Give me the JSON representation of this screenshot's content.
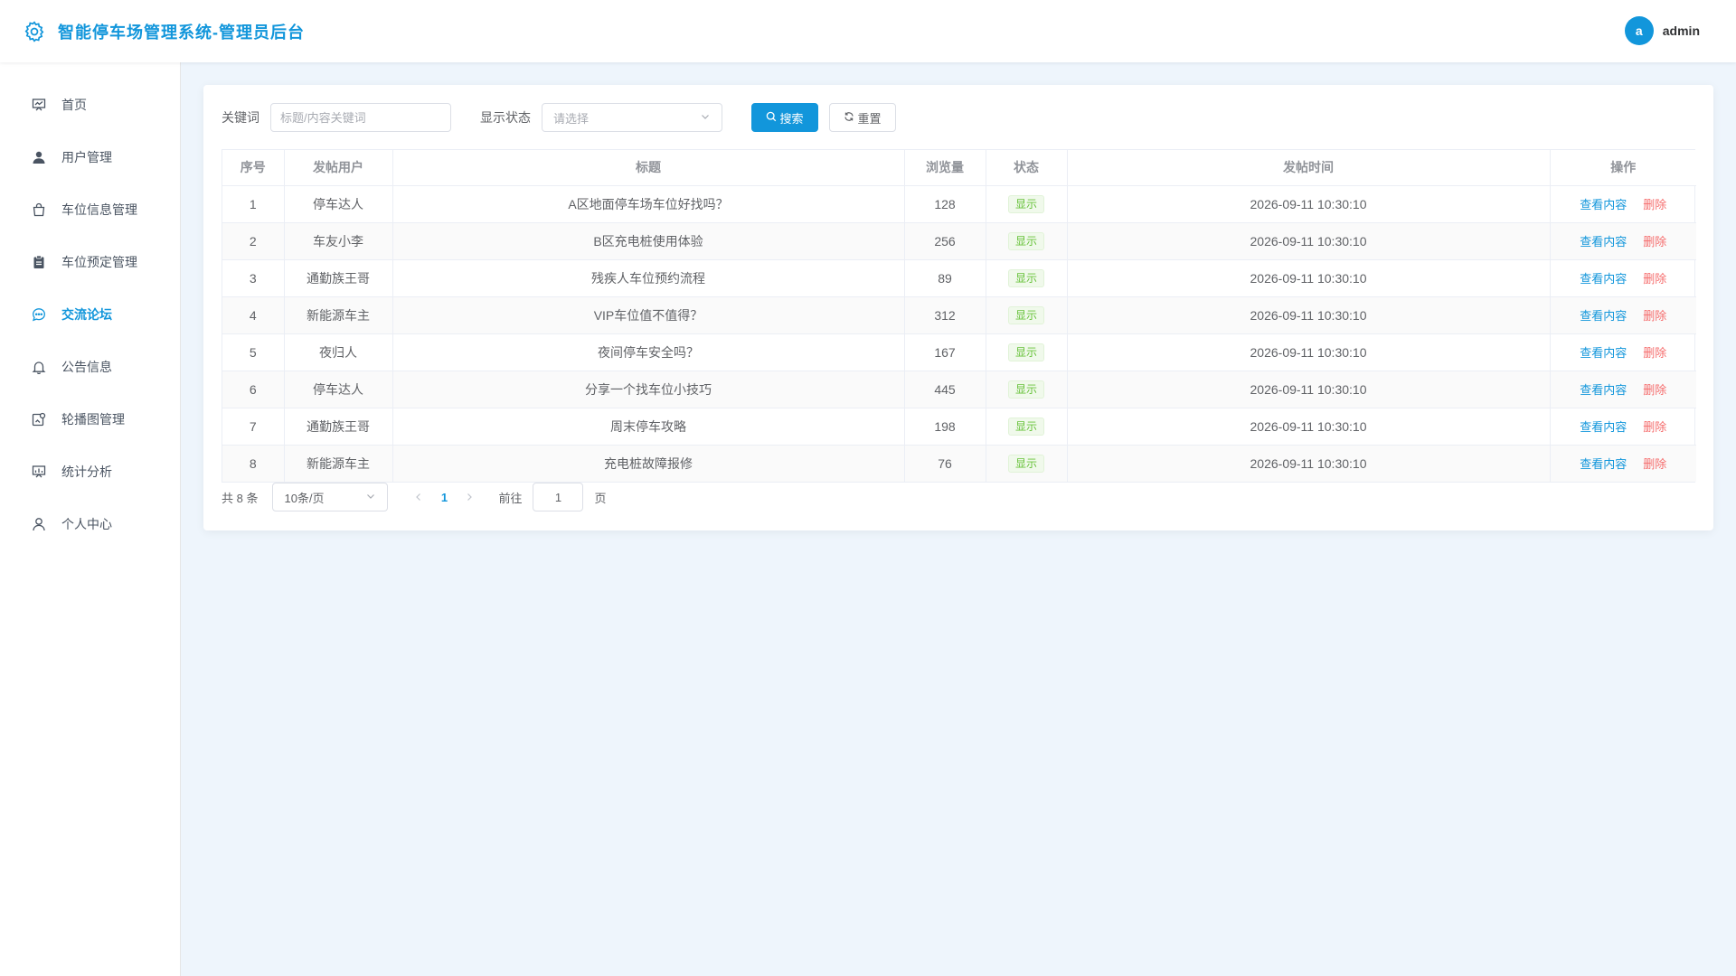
{
  "header": {
    "title": "智能停车场管理系统-管理员后台",
    "avatar_letter": "a",
    "username": "admin",
    "accent_color": "#1296db"
  },
  "sidebar": {
    "items": [
      {
        "label": "首页",
        "icon": "chart-board-icon"
      },
      {
        "label": "用户管理",
        "icon": "user-icon"
      },
      {
        "label": "车位信息管理",
        "icon": "bag-icon"
      },
      {
        "label": "车位预定管理",
        "icon": "clipboard-icon"
      },
      {
        "label": "交流论坛",
        "icon": "chat-icon",
        "active": true
      },
      {
        "label": "公告信息",
        "icon": "bell-icon"
      },
      {
        "label": "轮播图管理",
        "icon": "image-icon"
      },
      {
        "label": "统计分析",
        "icon": "chart-board-icon"
      },
      {
        "label": "个人中心",
        "icon": "person-icon"
      }
    ]
  },
  "filters": {
    "keyword_label": "关键词",
    "keyword_placeholder": "标题/内容关键词",
    "keyword_value": "",
    "status_label": "显示状态",
    "status_placeholder": "请选择",
    "search_label": "搜索",
    "reset_label": "重置"
  },
  "table": {
    "headers": [
      "序号",
      "发帖用户",
      "标题",
      "浏览量",
      "状态",
      "发帖时间",
      "操作"
    ],
    "rows": [
      {
        "index": "1",
        "user": "停车达人",
        "title": "A区地面停车场车位好找吗？",
        "views": "128",
        "status": "显示",
        "time": "2026-09-11 10:30:10"
      },
      {
        "index": "2",
        "user": "车友小李",
        "title": "B区充电桩使用体验",
        "views": "256",
        "status": "显示",
        "time": "2026-09-11 10:30:10"
      },
      {
        "index": "3",
        "user": "通勤族王哥",
        "title": "残疾人车位预约流程",
        "views": "89",
        "status": "显示",
        "time": "2026-09-11 10:30:10"
      },
      {
        "index": "4",
        "user": "新能源车主",
        "title": "VIP车位值不值得？",
        "views": "312",
        "status": "显示",
        "time": "2026-09-11 10:30:10"
      },
      {
        "index": "5",
        "user": "夜归人",
        "title": "夜间停车安全吗？",
        "views": "167",
        "status": "显示",
        "time": "2026-09-11 10:30:10"
      },
      {
        "index": "6",
        "user": "停车达人",
        "title": "分享一个找车位小技巧",
        "views": "445",
        "status": "显示",
        "time": "2026-09-11 10:30:10"
      },
      {
        "index": "7",
        "user": "通勤族王哥",
        "title": "周末停车攻略",
        "views": "198",
        "status": "显示",
        "time": "2026-09-11 10:30:10"
      },
      {
        "index": "8",
        "user": "新能源车主",
        "title": "充电桩故障报修",
        "views": "76",
        "status": "显示",
        "time": "2026-09-11 10:30:10"
      }
    ],
    "view_label": "查看内容",
    "delete_label": "删除"
  },
  "pagination": {
    "total_text": "共 8 条",
    "page_size": "10条/页",
    "current_page": "1",
    "goto_label": "前往",
    "goto_value": "1",
    "page_suffix": "页"
  }
}
